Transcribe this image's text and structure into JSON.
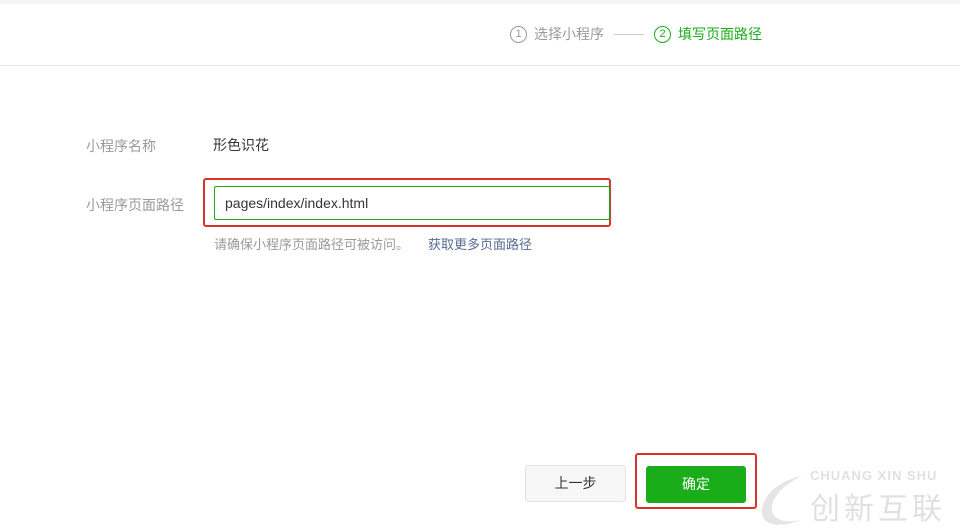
{
  "steps": [
    {
      "num": "1",
      "label": "选择小程序",
      "state": "done"
    },
    {
      "num": "2",
      "label": "填写页面路径",
      "state": "active"
    }
  ],
  "form": {
    "name_label": "小程序名称",
    "name_value": "形色识花",
    "path_label": "小程序页面路径",
    "path_value": "pages/index/index.html",
    "hint": "请确保小程序页面路径可被访问。",
    "hint_link": "获取更多页面路径"
  },
  "buttons": {
    "prev_label": "上一步",
    "ok_label": "确定"
  },
  "watermark": {
    "top_text": "CHUANG XIN SHU",
    "main_text": "创新互联"
  },
  "colors": {
    "accent_green": "#1aad19",
    "highlight_red": "#d9332a",
    "link_blue": "#576b95",
    "muted_text": "#9a9a9a"
  }
}
